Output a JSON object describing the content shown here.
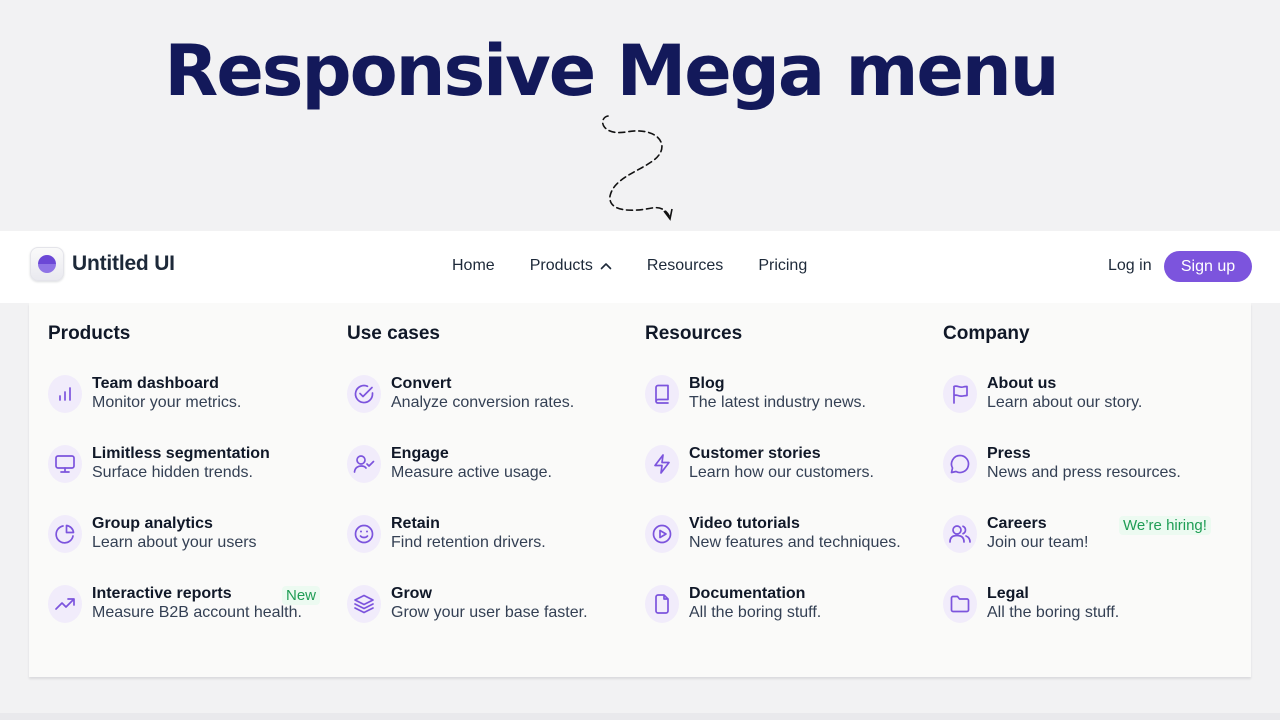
{
  "hero": {
    "title": "Responsive Mega menu"
  },
  "brand": {
    "name": "Untitled UI",
    "accent": "#7c54dd",
    "title_color": "#13195a"
  },
  "nav": {
    "links": [
      "Home",
      "Products",
      "Resources",
      "Pricing"
    ],
    "login": "Log in",
    "signup": "Sign up"
  },
  "mega": {
    "columns": [
      {
        "title": "Products",
        "items": [
          {
            "title": "Team dashboard",
            "desc": "Monitor your metrics.",
            "icon": "bar-chart-icon"
          },
          {
            "title": "Limitless segmentation",
            "desc": "Surface hidden trends.",
            "icon": "monitor-icon"
          },
          {
            "title": "Group analytics",
            "desc": "Learn about your users",
            "icon": "pie-chart-icon"
          },
          {
            "title": "Interactive reports",
            "desc": "Measure B2B account health.",
            "icon": "trend-up-icon",
            "badge": "New"
          }
        ]
      },
      {
        "title": "Use cases",
        "items": [
          {
            "title": "Convert",
            "desc": "Analyze conversion rates.",
            "icon": "check-circle-icon"
          },
          {
            "title": "Engage",
            "desc": "Measure active usage.",
            "icon": "user-check-icon"
          },
          {
            "title": "Retain",
            "desc": "Find retention drivers.",
            "icon": "smile-icon"
          },
          {
            "title": "Grow",
            "desc": "Grow your user base faster.",
            "icon": "layers-icon"
          }
        ]
      },
      {
        "title": "Resources",
        "items": [
          {
            "title": "Blog",
            "desc": "The latest industry news.",
            "icon": "book-icon"
          },
          {
            "title": "Customer stories",
            "desc": "Learn how our customers.",
            "icon": "lightning-icon"
          },
          {
            "title": "Video tutorials",
            "desc": "New features and techniques.",
            "icon": "play-circle-icon"
          },
          {
            "title": "Documentation",
            "desc": "All the boring stuff.",
            "icon": "file-icon"
          }
        ]
      },
      {
        "title": "Company",
        "items": [
          {
            "title": "About us",
            "desc": "Learn about our story.",
            "icon": "flag-icon"
          },
          {
            "title": "Press",
            "desc": "News and press resources.",
            "icon": "message-circle-icon"
          },
          {
            "title": "Careers",
            "desc": "Join our team!",
            "icon": "users-icon",
            "badge": "We’re hiring!"
          },
          {
            "title": "Legal",
            "desc": "All the boring stuff.",
            "icon": "folder-icon"
          }
        ]
      }
    ]
  }
}
